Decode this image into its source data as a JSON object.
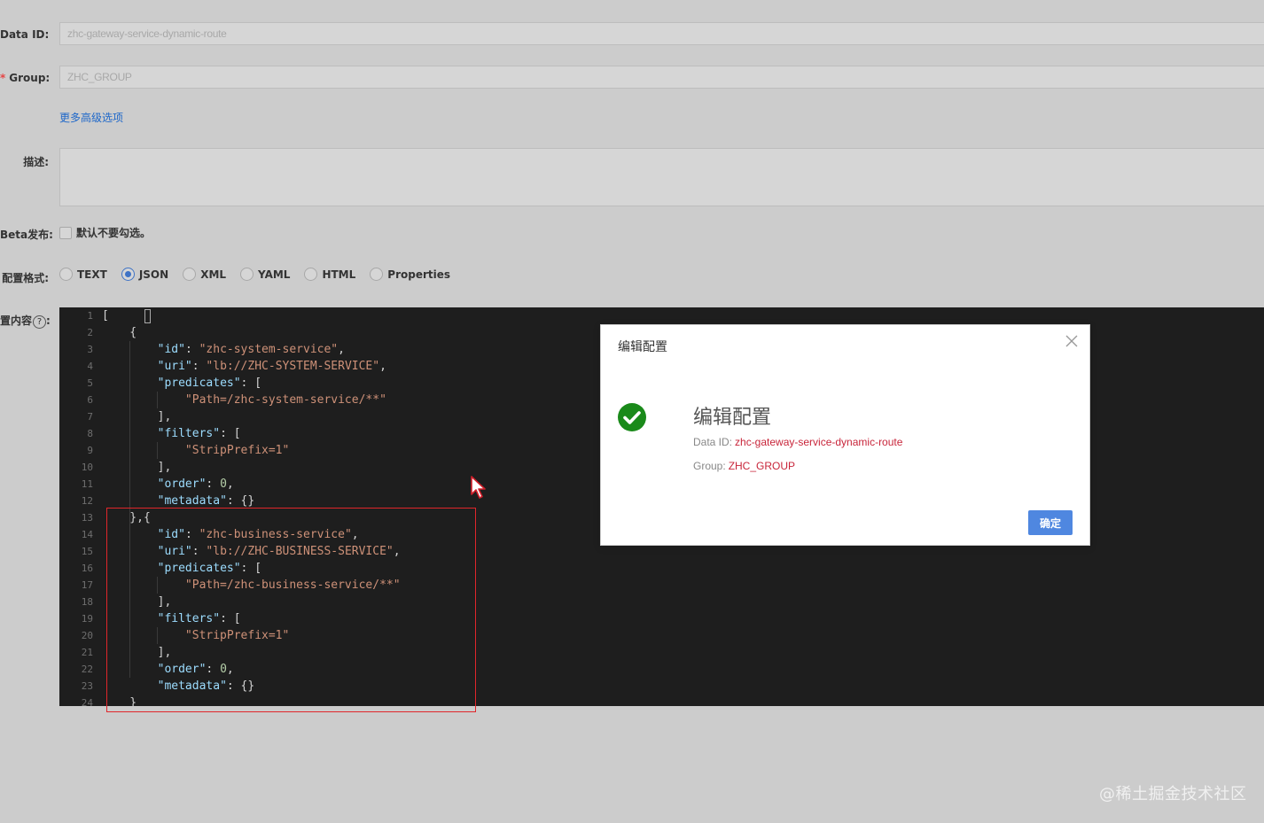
{
  "form": {
    "data_id_label": "Data ID:",
    "data_id_value": "zhc-gateway-service-dynamic-route",
    "group_required_mark": "*",
    "group_label": "Group:",
    "group_value": "ZHC_GROUP",
    "advanced_link": "更多高级选项",
    "desc_label": "描述:",
    "beta_label": "Beta发布:",
    "beta_checkbox_text": "默认不要勾选。",
    "format_label": "配置格式:",
    "formats": [
      "TEXT",
      "JSON",
      "XML",
      "YAML",
      "HTML",
      "Properties"
    ],
    "selected_format": "JSON",
    "content_label": "置内容",
    "help_glyph": "?"
  },
  "editor": {
    "line_numbers": [
      "1",
      "2",
      "3",
      "4",
      "5",
      "6",
      "7",
      "8",
      "9",
      "10",
      "11",
      "12",
      "13",
      "14",
      "15",
      "16",
      "17",
      "18",
      "19",
      "20",
      "21",
      "22",
      "23",
      "24"
    ]
  },
  "dialog": {
    "title": "编辑配置",
    "message_title": "编辑配置",
    "data_id_label": "Data ID:",
    "data_id_value": "zhc-gateway-service-dynamic-route",
    "group_label": "Group:",
    "group_value": "ZHC_GROUP",
    "ok_label": "确定"
  },
  "watermark": "@稀土掘金技术社区"
}
